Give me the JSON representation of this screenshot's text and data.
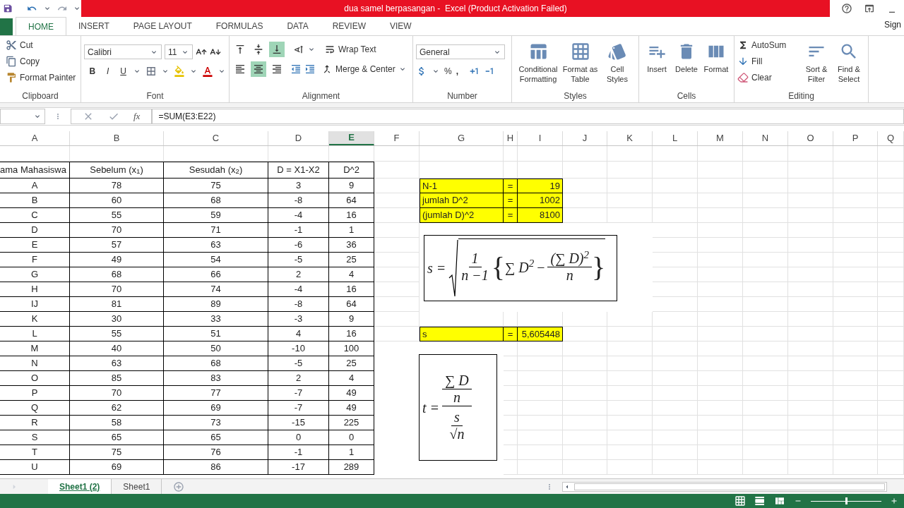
{
  "window": {
    "title": "dua samel berpasangan -  Excel (Product Activation Failed)"
  },
  "ribbon_tabs": [
    {
      "label": "HOME",
      "selected": true
    },
    {
      "label": "INSERT",
      "selected": false
    },
    {
      "label": "PAGE LAYOUT",
      "selected": false
    },
    {
      "label": "FORMULAS",
      "selected": false
    },
    {
      "label": "DATA",
      "selected": false
    },
    {
      "label": "REVIEW",
      "selected": false
    },
    {
      "label": "VIEW",
      "selected": false
    }
  ],
  "account": "Sign",
  "clipboard": {
    "label": "Clipboard",
    "cut": "Cut",
    "copy": "Copy",
    "format_painter": "Format Painter"
  },
  "font": {
    "label": "Font",
    "name": "Calibri",
    "size": "11",
    "bold": "B",
    "italic": "I",
    "underline": "U"
  },
  "alignment": {
    "label": "Alignment",
    "vertical": [
      {
        "selected": false
      },
      {
        "selected": false
      },
      {
        "selected": true
      }
    ],
    "horizontal": [
      {
        "selected": false
      },
      {
        "selected": true
      },
      {
        "selected": false
      }
    ],
    "wrap_text": "Wrap Text",
    "merge_center": "Merge & Center"
  },
  "number": {
    "label": "Number",
    "format": "General",
    "percent": "%",
    "comma": ","
  },
  "styles": {
    "label": "Styles",
    "buttons": [
      {
        "line1": "Conditional",
        "line2": "Formatting"
      },
      {
        "line1": "Format as",
        "line2": "Table"
      },
      {
        "line1": "Cell",
        "line2": "Styles"
      }
    ]
  },
  "cells": {
    "label": "Cells",
    "buttons": [
      "Insert",
      "Delete",
      "Format"
    ]
  },
  "editing": {
    "label": "Editing",
    "autosum": "AutoSum",
    "fill": "Fill",
    "clear": "Clear",
    "buttons": [
      {
        "line1": "Sort &",
        "line2": "Filter"
      },
      {
        "line1": "Find &",
        "line2": "Select"
      }
    ]
  },
  "formula_bar": {
    "fx": "fx",
    "formula": "=SUM(E3:E22)"
  },
  "columns": [
    {
      "label": "A",
      "selected": false
    },
    {
      "label": "B",
      "selected": false
    },
    {
      "label": "C",
      "selected": false
    },
    {
      "label": "D",
      "selected": false
    },
    {
      "label": "E",
      "selected": true
    },
    {
      "label": "F",
      "selected": false
    },
    {
      "label": "G",
      "selected": false
    },
    {
      "label": "H",
      "selected": false
    },
    {
      "label": "I",
      "selected": false
    },
    {
      "label": "J",
      "selected": false
    },
    {
      "label": "K",
      "selected": false
    },
    {
      "label": "L",
      "selected": false
    },
    {
      "label": "M",
      "selected": false
    },
    {
      "label": "N",
      "selected": false
    },
    {
      "label": "O",
      "selected": false
    },
    {
      "label": "P",
      "selected": false
    },
    {
      "label": "Q",
      "selected": false
    }
  ],
  "table": {
    "headers": [
      "ama Mahasiswa",
      "Sebelum (x$_{1}$)",
      "Sesudah (x$_{2}$)",
      "D = X1-X2",
      "D^2"
    ],
    "rows": [
      [
        "A",
        "78",
        "75",
        "3",
        "9"
      ],
      [
        "B",
        "60",
        "68",
        "-8",
        "64"
      ],
      [
        "C",
        "55",
        "59",
        "-4",
        "16"
      ],
      [
        "D",
        "70",
        "71",
        "-1",
        "1"
      ],
      [
        "E",
        "57",
        "63",
        "-6",
        "36"
      ],
      [
        "F",
        "49",
        "54",
        "-5",
        "25"
      ],
      [
        "G",
        "68",
        "66",
        "2",
        "4"
      ],
      [
        "H",
        "70",
        "74",
        "-4",
        "16"
      ],
      [
        "IJ",
        "81",
        "89",
        "-8",
        "64"
      ],
      [
        "K",
        "30",
        "33",
        "-3",
        "9"
      ],
      [
        "L",
        "55",
        "51",
        "4",
        "16"
      ],
      [
        "M",
        "40",
        "50",
        "-10",
        "100"
      ],
      [
        "N",
        "63",
        "68",
        "-5",
        "25"
      ],
      [
        "O",
        "85",
        "83",
        "2",
        "4"
      ],
      [
        "P",
        "70",
        "77",
        "-7",
        "49"
      ],
      [
        "Q",
        "62",
        "69",
        "-7",
        "49"
      ],
      [
        "R",
        "58",
        "73",
        "-15",
        "225"
      ],
      [
        "S",
        "65",
        "65",
        "0",
        "0"
      ],
      [
        "T",
        "75",
        "76",
        "-1",
        "1"
      ],
      [
        "U",
        "69",
        "86",
        "-17",
        "289"
      ]
    ]
  },
  "summary": [
    {
      "label": "N-1",
      "eq": "=",
      "value": "19"
    },
    {
      "label": "jumlah D^2",
      "eq": "=",
      "value": "1002"
    },
    {
      "label": "(jumlah D)^2",
      "eq": "=",
      "value": "8100"
    }
  ],
  "s_result": {
    "label": "s",
    "eq": "=",
    "value": "5,605448"
  },
  "equation_s": {
    "lhs": "s =",
    "num": "1",
    "den": "n −1",
    "open": "{",
    "sum": "∑ D$^{2}$",
    "minus": "−",
    "inner_num": "(∑ D)$^{2}$",
    "inner_den": "n",
    "close": "}"
  },
  "equation_t": {
    "lhs": "t =",
    "top_num": "∑ D",
    "top_den": "n",
    "bottom_num": "s",
    "bottom_den": "√n"
  },
  "zoom": {
    "level": 0.5
  },
  "sheet_tabs": [
    {
      "label": "Sheet1 (2)",
      "selected": true
    },
    {
      "label": "Sheet1",
      "selected": false
    }
  ]
}
